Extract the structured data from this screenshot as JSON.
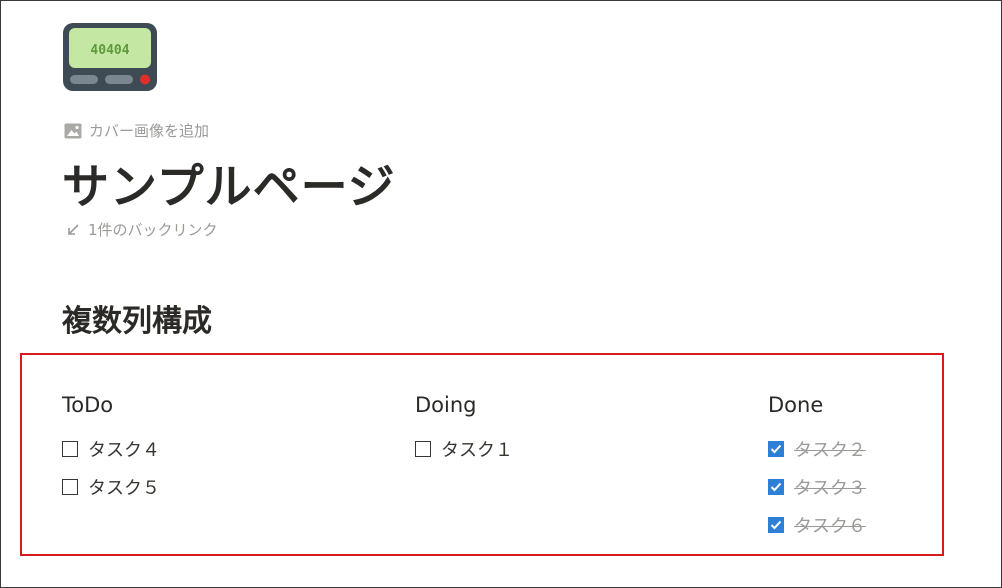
{
  "page": {
    "icon": "pager-icon",
    "icon_display_text": "40404",
    "add_cover_label": "カバー画像を追加",
    "title": "サンプルページ",
    "backlinks_label": "1件のバックリンク"
  },
  "section": {
    "heading": "複数列構成"
  },
  "columns": [
    {
      "title": "ToDo",
      "items": [
        {
          "text": "タスク４",
          "checked": false
        },
        {
          "text": "タスク５",
          "checked": false
        }
      ]
    },
    {
      "title": "Doing",
      "items": [
        {
          "text": "タスク１",
          "checked": false
        }
      ]
    },
    {
      "title": "Done",
      "items": [
        {
          "text": "タスク２",
          "checked": true
        },
        {
          "text": "タスク３",
          "checked": true
        },
        {
          "text": "タスク６",
          "checked": true
        }
      ]
    }
  ],
  "colors": {
    "highlight_border": "#d71a1a",
    "checkbox_checked": "#2e7fd6",
    "text": "#37352f",
    "muted": "#9b9a97"
  }
}
